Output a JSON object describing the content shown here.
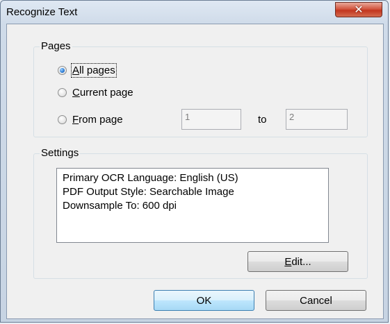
{
  "window": {
    "title": "Recognize Text"
  },
  "pages_group": {
    "legend": "Pages",
    "all_pages": {
      "label_hotkey": "A",
      "label_rest": "ll pages",
      "checked": true
    },
    "current_page": {
      "label_hotkey": "C",
      "label_rest": "urrent page",
      "checked": false
    },
    "from_page": {
      "label_hotkey": "F",
      "label_rest": "rom page",
      "checked": false
    },
    "from_value": "1",
    "to_label": "to",
    "to_value": "2"
  },
  "settings_group": {
    "legend": "Settings",
    "lines": [
      "Primary OCR Language: English (US)",
      "PDF Output Style: Searchable Image",
      "Downsample To: 600 dpi"
    ],
    "edit_hotkey": "E",
    "edit_rest": "dit..."
  },
  "buttons": {
    "ok": "OK",
    "cancel": "Cancel"
  },
  "icons": {
    "close": "close-icon"
  }
}
